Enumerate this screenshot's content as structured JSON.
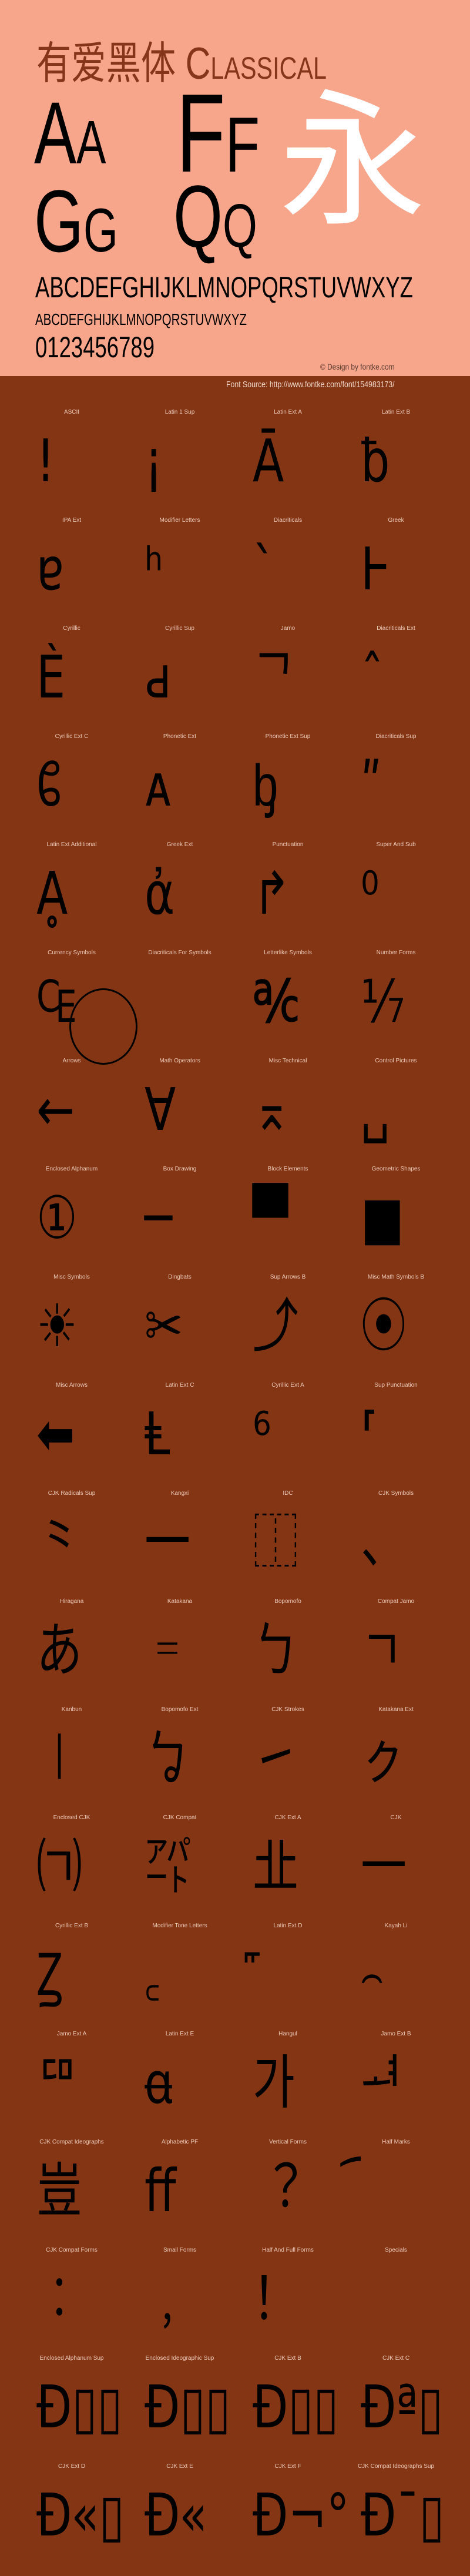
{
  "colors": {
    "header_bg": "#F8A68B",
    "body_bg": "#843514",
    "title": "#84351A",
    "glyph": "#000000",
    "hero_glyph": "#FFFFFF"
  },
  "header": {
    "title": "有爱黑体 Classical",
    "sample_aa": "Aa",
    "sample_ff": "Ff",
    "sample_gg": "Gg",
    "sample_qq": "Qq",
    "sample_cjk": "永",
    "uppercase": "ABCDEFGHIJKLMNOPQRSTUVWXYZ",
    "lowercase": "abcdefghijklmnopqrstuvwxyz",
    "digits": "0123456789",
    "credit": "© Design by fontke.com",
    "source": "Font Source: http://www.fontke.com/font/154983173/"
  },
  "blocks": [
    {
      "label": "ASCII",
      "glyph": "!"
    },
    {
      "label": "Latin 1 Sup",
      "glyph": "¡"
    },
    {
      "label": "Latin Ext A",
      "glyph": "Ā"
    },
    {
      "label": "Latin Ext B",
      "glyph": "ƀ"
    },
    {
      "label": "IPA Ext",
      "glyph": "ɐ"
    },
    {
      "label": "Modifier Letters",
      "glyph": "ʰ"
    },
    {
      "label": "Diacriticals",
      "glyph": "ˋ"
    },
    {
      "label": "Greek",
      "glyph": "Ͱ"
    },
    {
      "label": "Cyrillic",
      "glyph": "Ѐ"
    },
    {
      "label": "Cyrillic Sup",
      "glyph": "ԁ"
    },
    {
      "label": "Jamo",
      "glyph": "ᄀ"
    },
    {
      "label": "Diacriticals Ext",
      "glyph": "ˆ"
    },
    {
      "label": "Cyrillic Ext C",
      "glyph": "ᲀ"
    },
    {
      "label": "Phonetic Ext",
      "glyph": "ᴀ"
    },
    {
      "label": "Phonetic Ext Sup",
      "glyph": "ᶀ"
    },
    {
      "label": "Diacriticals Sup",
      "glyph": "ʺ"
    },
    {
      "label": "Latin Ext Additional",
      "glyph": "Ḁ"
    },
    {
      "label": "Greek Ext",
      "glyph": "ἀ"
    },
    {
      "label": "Punctuation",
      "glyph": "↱"
    },
    {
      "label": "Super And Sub",
      "glyph": "⁰"
    },
    {
      "label": "Currency Symbols",
      "glyph": "₠"
    },
    {
      "label": "Diacriticals For Symbols",
      "glyph": ""
    },
    {
      "label": "Letterlike Symbols",
      "glyph": "℀"
    },
    {
      "label": "Number Forms",
      "glyph": "⅐"
    },
    {
      "label": "Arrows",
      "glyph": "←"
    },
    {
      "label": "Math Operators",
      "glyph": "∀"
    },
    {
      "label": "Misc Technical",
      "glyph": "⌅"
    },
    {
      "label": "Control Pictures",
      "glyph": "␣"
    },
    {
      "label": "Enclosed Alphanum",
      "glyph": "①"
    },
    {
      "label": "Box Drawing",
      "glyph": "─"
    },
    {
      "label": "Block Elements",
      "glyph": "▀"
    },
    {
      "label": "Geometric Shapes",
      "glyph": "■"
    },
    {
      "label": "Misc Symbols",
      "glyph": "☀"
    },
    {
      "label": "Dingbats",
      "glyph": "✂"
    },
    {
      "label": "Sup Arrows B",
      "glyph": "⤴"
    },
    {
      "label": "Misc Math Symbols B",
      "glyph": "⦿"
    },
    {
      "label": "Misc Arrows",
      "glyph": "⬅"
    },
    {
      "label": "Latin Ext C",
      "glyph": "Ⱡ"
    },
    {
      "label": "Cyrillic Ext A",
      "glyph": "⁶"
    },
    {
      "label": "Sup Punctuation",
      "glyph": "⸢"
    },
    {
      "label": "CJK Radicals Sup",
      "glyph": "⺀"
    },
    {
      "label": "Kangxi",
      "glyph": "⼀"
    },
    {
      "label": "IDC",
      "glyph": "⿰"
    },
    {
      "label": "CJK Symbols",
      "glyph": "、"
    },
    {
      "label": "Hiragana",
      "glyph": "あ"
    },
    {
      "label": "Katakana",
      "glyph": "゠"
    },
    {
      "label": "Bopomofo",
      "glyph": "ㄅ"
    },
    {
      "label": "Compat Jamo",
      "glyph": "ㄱ"
    },
    {
      "label": "Kanbun",
      "glyph": "㆐"
    },
    {
      "label": "Bopomofo Ext",
      "glyph": "ㆠ"
    },
    {
      "label": "CJK Strokes",
      "glyph": "㇀"
    },
    {
      "label": "Katakana Ext",
      "glyph": "ㇰ"
    },
    {
      "label": "Enclosed CJK",
      "glyph": "㈀"
    },
    {
      "label": "CJK Compat",
      "glyph": "㌀"
    },
    {
      "label": "CJK Ext A",
      "glyph": "㐀"
    },
    {
      "label": "CJK",
      "glyph": "一"
    },
    {
      "label": "Cyrillic Ext B",
      "glyph": "Ꙁ"
    },
    {
      "label": "Modifier Tone Letters",
      "glyph": "꜀"
    },
    {
      "label": "Latin Ext D",
      "glyph": "꜠"
    },
    {
      "label": "Kayah Li",
      "glyph": "꤮"
    },
    {
      "label": "Jamo Ext A",
      "glyph": "ꥠ"
    },
    {
      "label": "Latin Ext E",
      "glyph": "ꬰ"
    },
    {
      "label": "Hangul",
      "glyph": "가"
    },
    {
      "label": "Jamo Ext B",
      "glyph": "ힰ"
    },
    {
      "label": "CJK Compat Ideographs",
      "glyph": "豈"
    },
    {
      "label": "Alphabetic PF",
      "glyph": "ﬀ"
    },
    {
      "label": "Vertical Forms",
      "glyph": "︖"
    },
    {
      "label": "Half Marks",
      "glyph": "︠"
    },
    {
      "label": "CJK Compat Forms",
      "glyph": "︰"
    },
    {
      "label": "Small Forms",
      "glyph": "﹐"
    },
    {
      "label": "Half And Full Forms",
      "glyph": "！"
    },
    {
      "label": "Specials",
      "glyph": "￼"
    },
    {
      "label": "Enclosed Alphanum Sup",
      "glyph": "Ð▯▯"
    },
    {
      "label": "Enclosed Ideographic Sup",
      "glyph": "Ð▯▯"
    },
    {
      "label": "CJK Ext B",
      "glyph": "Ð▯▯"
    },
    {
      "label": "CJK Ext C",
      "glyph": "Ðª▯"
    },
    {
      "label": "CJK Ext D",
      "glyph": "Ð«▯"
    },
    {
      "label": "CJK Ext E",
      "glyph": "Ð«"
    },
    {
      "label": "CJK Ext F",
      "glyph": "Ð¬°"
    },
    {
      "label": "CJK Compat Ideographs Sup",
      "glyph": "Ð¯▯"
    }
  ]
}
